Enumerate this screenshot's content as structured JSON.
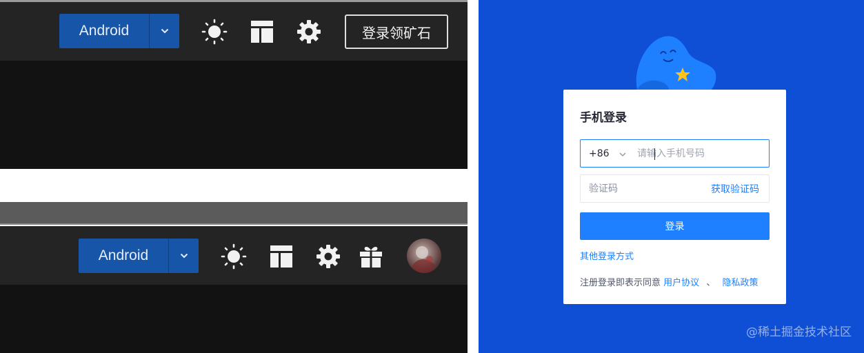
{
  "top_toolbar": {
    "platform_label": "Android",
    "login_label": "登录领矿石",
    "icons": [
      "chevron-down-icon",
      "sun-icon",
      "layout-icon",
      "gear-icon"
    ]
  },
  "bottom_toolbar": {
    "platform_label": "Android",
    "icons": [
      "chevron-down-icon",
      "sun-icon",
      "layout-icon",
      "gear-icon",
      "gift-icon",
      "avatar"
    ]
  },
  "login_card": {
    "title": "手机登录",
    "country_code": "+86",
    "phone_placeholder": "请输入手机号码",
    "code_placeholder": "验证码",
    "get_code_label": "获取验证码",
    "submit_label": "登录",
    "other_login_label": "其他登录方式",
    "agreement_prefix": "注册登录即表示同意",
    "user_agreement_label": "用户协议",
    "agreement_separator": "、",
    "privacy_label": "隐私政策"
  },
  "watermark": "@稀土掘金技术社区",
  "colors": {
    "toolbar_bg": "#242424",
    "content_bg": "#121212",
    "button_blue": "#1655a8",
    "login_bg": "#0e4fd6",
    "accent": "#1e80ff"
  }
}
